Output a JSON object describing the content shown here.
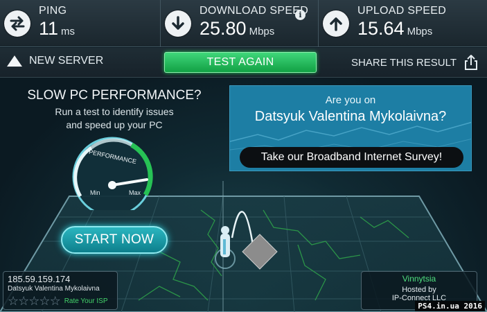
{
  "metrics": {
    "ping": {
      "label": "PING",
      "value": "11",
      "unit": "ms",
      "icon": "swap-arrows-icon"
    },
    "download": {
      "label": "DOWNLOAD SPEED",
      "value": "25.80",
      "unit": "Mbps",
      "icon": "down-arrow-icon",
      "info": "i"
    },
    "upload": {
      "label": "UPLOAD SPEED",
      "value": "15.64",
      "unit": "Mbps",
      "icon": "up-arrow-icon"
    }
  },
  "actions": {
    "new_server": "NEW SERVER",
    "test_again": "TEST AGAIN",
    "share": "SHARE THIS RESULT"
  },
  "promo": {
    "title": "SLOW PC PERFORMANCE?",
    "line1": "Run a test to identify issues",
    "line2": "and speed up your PC",
    "gauge_label": "PERFORMANCE",
    "gauge_min": "Min",
    "gauge_max": "Max",
    "start": "START NOW"
  },
  "survey": {
    "question": "Are you on",
    "isp": "Datsyuk Valentina Mykolaivna?",
    "cta": "Take our Broadband Internet Survey!"
  },
  "client": {
    "ip": "185.59.159.174",
    "isp": "Datsyuk Valentina Mykolaivna",
    "rate": "Rate Your ISP",
    "stars": 0
  },
  "server": {
    "city": "Vinnytsia",
    "hosted_by": "Hosted by",
    "host": "IP-Connect LLC"
  },
  "watermark": "PS4.in.ua  2016",
  "colors": {
    "accent_green": "#21c05a",
    "accent_cyan": "#2fd0dc",
    "survey_blue": "#1d7ea4"
  }
}
